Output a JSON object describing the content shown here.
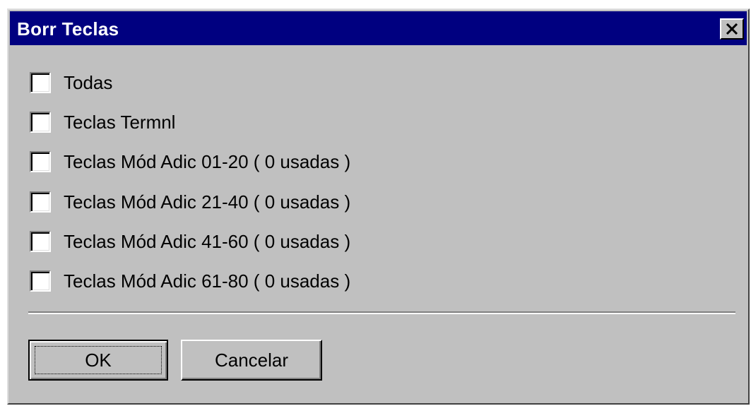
{
  "dialog": {
    "title": "Borr Teclas",
    "close_icon": "close-x-icon"
  },
  "options": [
    {
      "label": "Todas",
      "checked": false
    },
    {
      "label": "Teclas Termnl",
      "checked": false
    },
    {
      "label": "Teclas Mód Adic 01-20 ( 0 usadas )",
      "checked": false
    },
    {
      "label": "Teclas Mód Adic 21-40 ( 0 usadas )",
      "checked": false
    },
    {
      "label": "Teclas Mód Adic 41-60 ( 0 usadas )",
      "checked": false
    },
    {
      "label": "Teclas Mód Adic 61-80 ( 0 usadas )",
      "checked": false
    }
  ],
  "buttons": {
    "ok_label": "OK",
    "cancel_label": "Cancelar"
  },
  "colors": {
    "titlebar": "#000080",
    "face": "#c0c0c0"
  }
}
